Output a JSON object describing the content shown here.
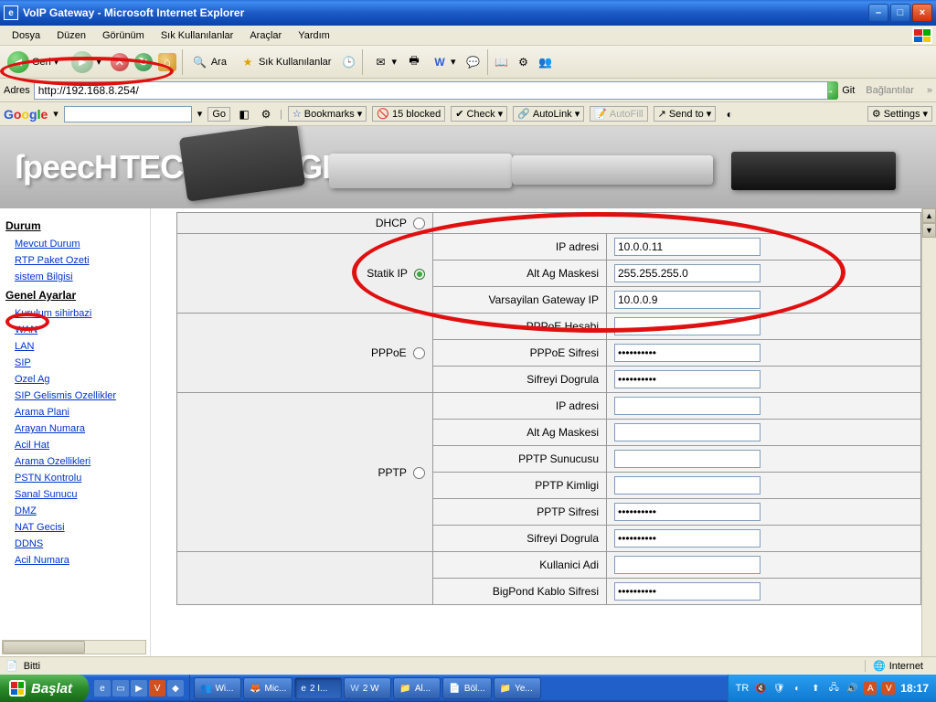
{
  "window": {
    "title": "VoIP Gateway - Microsoft Internet Explorer"
  },
  "menu": {
    "dosya": "Dosya",
    "duzen": "Düzen",
    "gorunum": "Görünüm",
    "sik": "Sık Kullanılanlar",
    "araclar": "Araçlar",
    "yardim": "Yardım"
  },
  "toolbar": {
    "geri": "Geri",
    "ara": "Ara",
    "fav": "Sık Kullanılanlar"
  },
  "address": {
    "label": "Adres",
    "url": "http://192.168.8.254/",
    "go": "Git",
    "links": "Bağlantılar"
  },
  "google": {
    "go": "Go",
    "bookmarks": "Bookmarks",
    "blocked": "15 blocked",
    "check": "Check",
    "autolink": "AutoLink",
    "autofill": "AutoFill",
    "sendto": "Send to",
    "settings": "Settings"
  },
  "banner": {
    "logo": "ſpeecH",
    "sub": "TECHNOLOGIES"
  },
  "sidebar": {
    "durum": "Durum",
    "durum_items": [
      "Mevcut Durum",
      "RTP Paket Ozeti",
      "sistem Bilgisi"
    ],
    "genel": "Genel Ayarlar",
    "genel_items": [
      "Kurulum sihirbazi",
      "WAN",
      "LAN",
      "SIP",
      "Ozel Ag",
      "SIP Gelismis Ozellikler",
      "Arama Plani",
      "Arayan Numara",
      "Acil Hat",
      "Arama Ozellikleri",
      "PSTN Kontrolu",
      "Sanal Sunucu",
      "DMZ",
      "NAT Gecisi",
      "DDNS",
      "Acil Numara"
    ]
  },
  "form": {
    "dhcp": "DHCP",
    "static": "Statik IP",
    "pppoe": "PPPoE",
    "pptp": "PPTP",
    "labels": {
      "ip": "IP adresi",
      "mask": "Alt Ag Maskesi",
      "gw": "Varsayilan Gateway IP",
      "pppoe_user": "PPPoE Hesabi",
      "pppoe_pass": "PPPoE Sifresi",
      "pass_confirm": "Sifreyi Dogrula",
      "pptp_srv": "PPTP Sunucusu",
      "pptp_id": "PPTP Kimligi",
      "pptp_pass": "PPTP Sifresi",
      "bp_user": "Kullanici Adi",
      "bp_pass": "BigPond Kablo Sifresi"
    },
    "values": {
      "ip": "10.0.0.11",
      "mask": "255.255.255.0",
      "gw": "10.0.0.9"
    }
  },
  "status": {
    "done": "Bitti",
    "zone": "Internet"
  },
  "taskbar": {
    "start": "Başlat",
    "tasks": [
      "Wi...",
      "Mic...",
      "2 I...",
      "2 W",
      "Al...",
      "Böl...",
      "Ye..."
    ],
    "lang": "TR",
    "clock": "18:17"
  }
}
